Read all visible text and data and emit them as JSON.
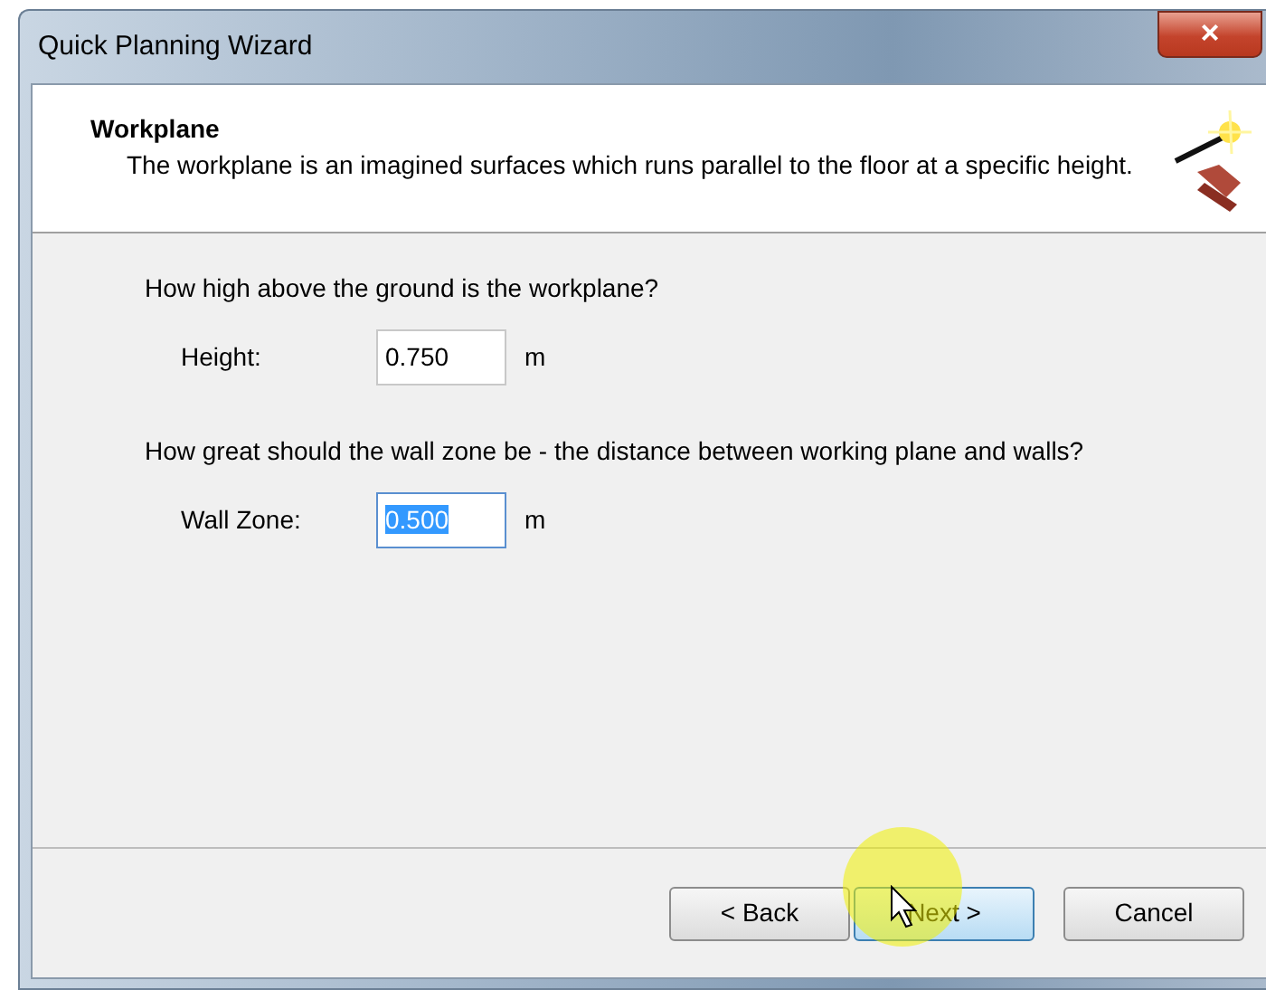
{
  "window": {
    "title": "Quick Planning Wizard",
    "close": "×"
  },
  "header": {
    "title": "Workplane",
    "description": "The workplane is an imagined surfaces which runs parallel to the floor at a specific height."
  },
  "sections": [
    {
      "question": "How high above the ground is the workplane?",
      "label": "Height:",
      "value": "0.750",
      "unit": "m",
      "text_selected": false
    },
    {
      "question": "How great should the wall zone be - the distance between working plane and walls?",
      "label": "Wall Zone:",
      "value": "0.500",
      "unit": "m",
      "text_selected": true
    }
  ],
  "buttons": [
    {
      "label": "< Back",
      "hovered": false
    },
    {
      "label": "Next >",
      "hovered": true
    },
    {
      "label": "Cancel",
      "hovered": false
    }
  ]
}
